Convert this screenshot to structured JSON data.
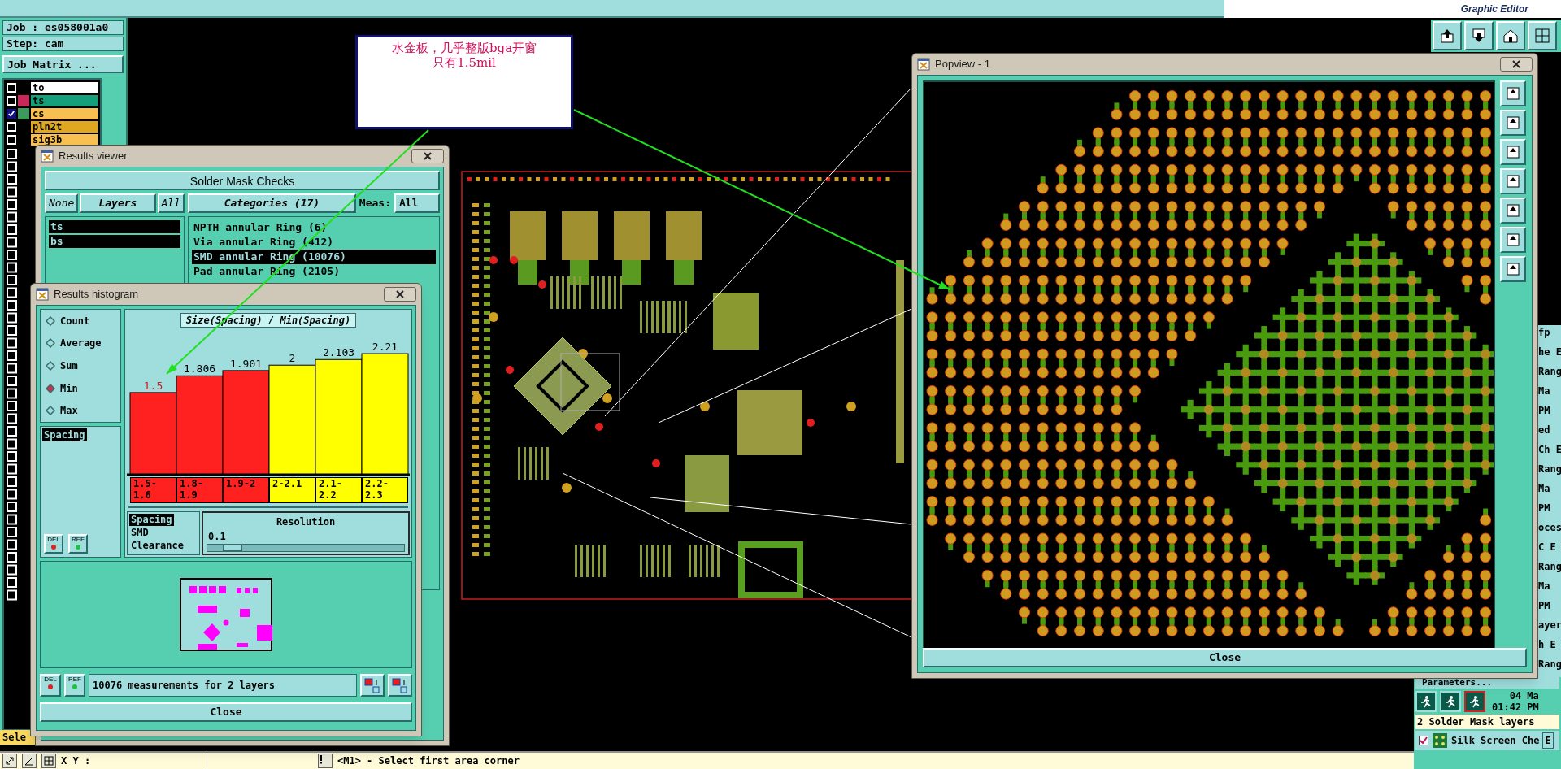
{
  "toolbar": {
    "logo_caption": "Graphic Editor"
  },
  "job_panel": {
    "job": "Job : es058001a0",
    "step": "Step: cam",
    "matrix_button": "Job Matrix ...",
    "layers": [
      {
        "name": "to",
        "kind": "document",
        "affected": false
      },
      {
        "name": "ts",
        "kind": "solder_mask",
        "color": "#c8285a",
        "affected": false
      },
      {
        "name": "cs",
        "kind": "signal",
        "color": "#3c9a5c",
        "affected": true
      },
      {
        "name": "pln2t",
        "kind": "power",
        "affected": false
      },
      {
        "name": "sig3b",
        "kind": "signal",
        "affected": false
      }
    ],
    "status_label": "Sele"
  },
  "callout": {
    "lines": [
      "水金板，几乎整版bga开窗",
      "只有1.5mil"
    ]
  },
  "results_viewer": {
    "title": "Results viewer",
    "heading": "Solder Mask Checks",
    "layer_buttons": [
      "None",
      "Layers",
      "All"
    ],
    "layers": [
      {
        "name": "ts",
        "selected": true
      },
      {
        "name": "bs",
        "selected": true
      }
    ],
    "categories_button": "Categories (17)",
    "meas_label": "Meas:",
    "meas_value": "All",
    "categories": [
      {
        "label": "NPTH annular Ring (6)",
        "selected": false
      },
      {
        "label": "Via annular Ring (412)",
        "selected": false
      },
      {
        "label": "SMD annular Ring (10076)",
        "selected": true
      },
      {
        "label": "Pad annular Ring (2105)",
        "selected": false
      }
    ]
  },
  "histogram": {
    "title": "Results histogram",
    "modes": [
      {
        "label": "Count",
        "selected": false
      },
      {
        "label": "Average",
        "selected": false
      },
      {
        "label": "Sum",
        "selected": false
      },
      {
        "label": "Min",
        "selected": true
      },
      {
        "label": "Max",
        "selected": false
      }
    ],
    "measures": [
      {
        "label": "Spacing",
        "selected": true
      }
    ],
    "side_buttons": [
      "DEL",
      "REF"
    ],
    "chart_title": "Size(Spacing) / Min(Spacing)",
    "chart_data": {
      "type": "bar",
      "categories": [
        "1.5-1.6",
        "1.8-1.9",
        "1.9-2",
        "2-2.1",
        "2.1-2.2",
        "2.2-2.3"
      ],
      "series": [
        {
          "color": "#ff2020",
          "values": [
            1.5,
            1.806,
            1.901,
            null,
            null,
            null
          ]
        },
        {
          "color": "#ffff00",
          "values": [
            null,
            null,
            null,
            2,
            2.103,
            2.21
          ]
        }
      ],
      "stacked": true,
      "data_labels": true
    },
    "types": [
      {
        "label": "Spacing",
        "selected": true
      },
      {
        "label": "SMD",
        "selected": false
      },
      {
        "label": "Clearance",
        "selected": false
      }
    ],
    "resolution_label": "Resolution",
    "resolution_value": "0.1",
    "resolution_slider": {
      "level": 0.08
    },
    "footer_buttons": [
      "DEL",
      "REF"
    ],
    "summary": "10076 measurements for 2 layers",
    "close": "Close"
  },
  "popview": {
    "title": "Popview - 1",
    "close": "Close"
  },
  "right_panel": {
    "fragments": [
      "fp",
      "he E",
      "Rang",
      "Ma",
      "PM",
      "ed",
      "Ch E",
      "Rang",
      "Ma",
      "PM",
      "oces",
      "C E",
      "Rang",
      "Ma",
      "PM",
      "ayer",
      "h E",
      "Rang"
    ],
    "parameters": "Parameters...",
    "date": "04 Ma",
    "time": "01:42 PM",
    "summary": "2 Solder Mask layers",
    "check": {
      "label": "Silk Screen Che",
      "checked": true
    },
    "check_suffix": "E"
  },
  "status_bar": {
    "coords_label": "X Y :",
    "message": "<M1> - Select first area corner"
  }
}
